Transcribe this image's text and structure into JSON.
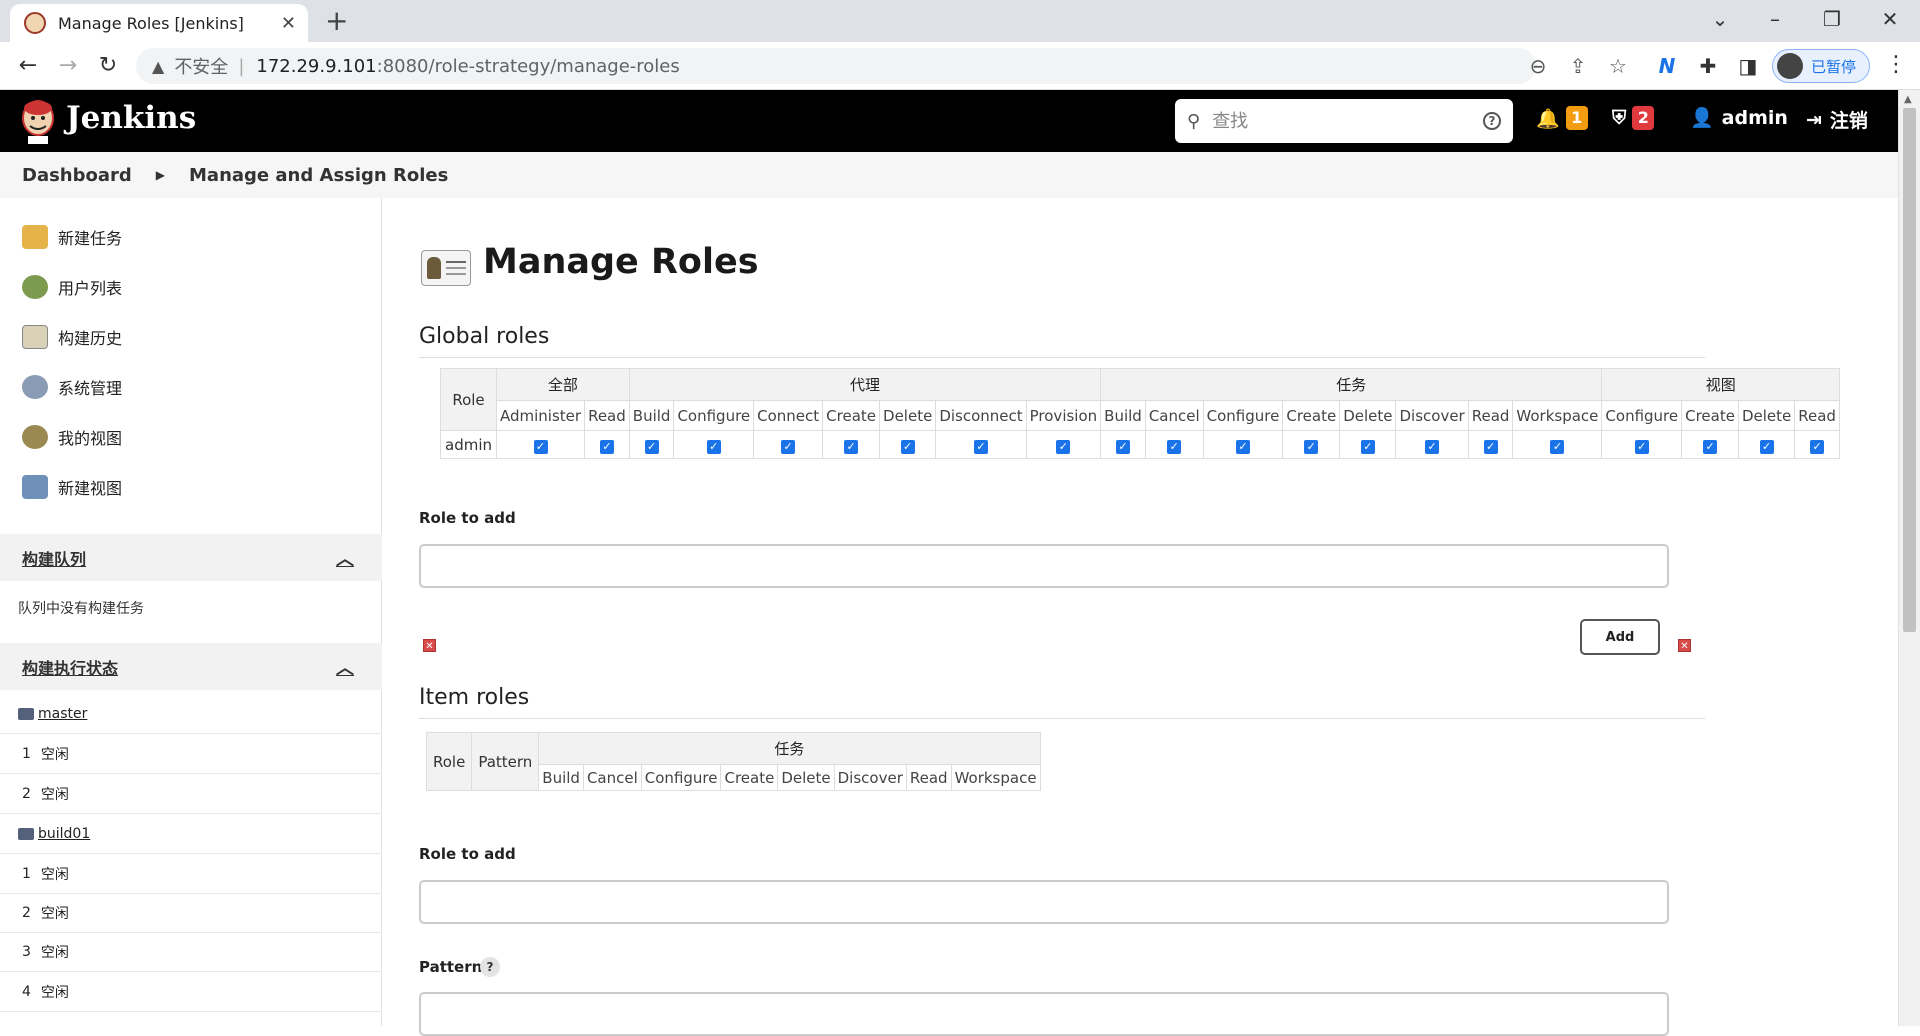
{
  "browser": {
    "tab_title": "Manage Roles [Jenkins]",
    "tab_close": "✕",
    "new_tab": "+",
    "insecure_label": "不安全",
    "url_host": "172.29.9.101",
    "url_path": ":8080/role-strategy/manage-roles",
    "paused_label": "已暂停"
  },
  "header": {
    "brand": "Jenkins",
    "search_placeholder": "查找",
    "notifications_count": "1",
    "security_count": "2",
    "user": "admin",
    "logout": "注销"
  },
  "breadcrumb": {
    "items": [
      "Dashboard",
      "Manage and Assign Roles"
    ]
  },
  "sidebar": {
    "tasks": [
      {
        "label": "新建任务",
        "icon": "new-item-icon"
      },
      {
        "label": "用户列表",
        "icon": "people-icon"
      },
      {
        "label": "构建历史",
        "icon": "build-history-icon"
      },
      {
        "label": "系统管理",
        "icon": "gear-icon"
      },
      {
        "label": "我的视图",
        "icon": "user-views-icon"
      },
      {
        "label": "新建视图",
        "icon": "folder-icon"
      }
    ],
    "queue": {
      "title": "构建队列",
      "empty": "队列中没有构建任务"
    },
    "executors": {
      "title": "构建执行状态",
      "rows": [
        {
          "type": "node",
          "label": "master"
        },
        {
          "type": "exec",
          "num": "1",
          "status": "空闲"
        },
        {
          "type": "exec",
          "num": "2",
          "status": "空闲"
        },
        {
          "type": "node",
          "label": "build01"
        },
        {
          "type": "exec",
          "num": "1",
          "status": "空闲"
        },
        {
          "type": "exec",
          "num": "2",
          "status": "空闲"
        },
        {
          "type": "exec",
          "num": "3",
          "status": "空闲"
        },
        {
          "type": "exec",
          "num": "4",
          "status": "空闲"
        }
      ]
    }
  },
  "main": {
    "title": "Manage Roles",
    "global_roles": {
      "heading": "Global roles",
      "role_header": "Role",
      "groups": [
        {
          "name": "全部",
          "perms": [
            "Administer",
            "Read"
          ]
        },
        {
          "name": "代理",
          "perms": [
            "Build",
            "Configure",
            "Connect",
            "Create",
            "Delete",
            "Disconnect",
            "Provision"
          ]
        },
        {
          "name": "任务",
          "perms": [
            "Build",
            "Cancel",
            "Configure",
            "Create",
            "Delete",
            "Discover",
            "Read",
            "Workspace"
          ]
        },
        {
          "name": "视图",
          "perms": [
            "Configure",
            "Create",
            "Delete",
            "Read"
          ]
        }
      ],
      "rows": [
        {
          "role": "admin",
          "all_checked": true
        }
      ]
    },
    "role_to_add_label": "Role to add",
    "add_button": "Add",
    "item_roles": {
      "heading": "Item roles",
      "role_header": "Role",
      "pattern_header": "Pattern",
      "group": "任务",
      "perms": [
        "Build",
        "Cancel",
        "Configure",
        "Create",
        "Delete",
        "Discover",
        "Read",
        "Workspace"
      ]
    },
    "item_role_to_add_label": "Role to add",
    "pattern_label": "Pattern",
    "pattern_help": "?"
  }
}
